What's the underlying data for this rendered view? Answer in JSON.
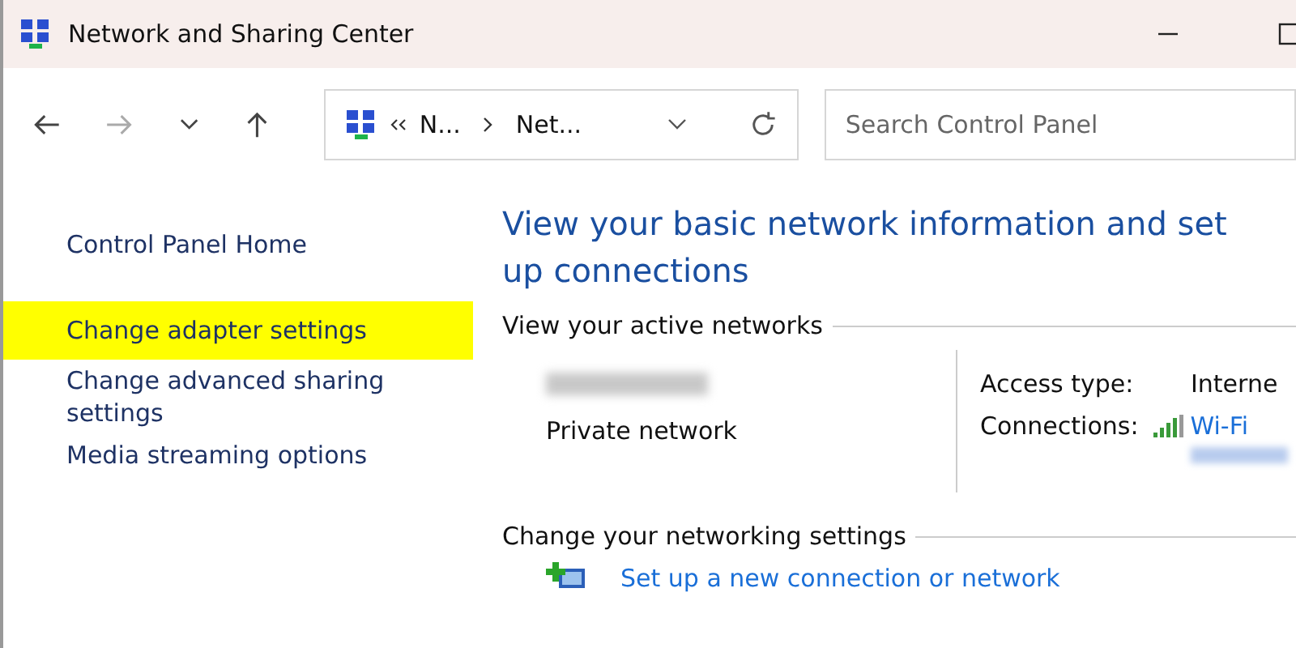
{
  "window": {
    "title": "Network and Sharing Center"
  },
  "address_bar": {
    "crumbs": [
      "N...",
      "Net..."
    ]
  },
  "search": {
    "placeholder": "Search Control Panel"
  },
  "sidebar": {
    "items": [
      {
        "label": "Control Panel Home",
        "highlighted": false
      },
      {
        "label": "Change adapter settings",
        "highlighted": true
      },
      {
        "label": "Change advanced sharing settings",
        "highlighted": false
      },
      {
        "label": "Media streaming options",
        "highlighted": false
      }
    ]
  },
  "main": {
    "heading": "View your basic network information and set up connections",
    "active_networks": {
      "title": "View your active networks",
      "network_type": "Private network",
      "access_type_label": "Access type:",
      "access_type_value": "Interne",
      "connections_label": "Connections:",
      "connection": "Wi-Fi"
    },
    "settings": {
      "title": "Change your networking settings",
      "links": [
        "Set up a new connection or network"
      ]
    }
  }
}
